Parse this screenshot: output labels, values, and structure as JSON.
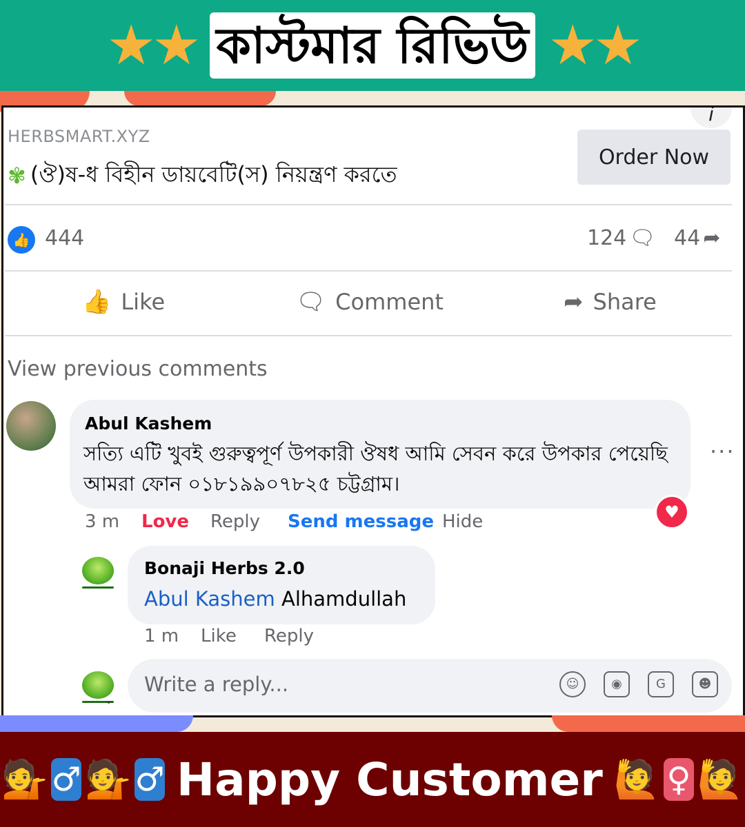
{
  "top_banner": {
    "title": "কাস্টমার রিভিউ",
    "stars_left": "★★",
    "stars_right": "★★",
    "accent": "#0ea987"
  },
  "ad": {
    "domain": "HERBSMART.XYZ",
    "headline": "(ঔ)ষ-ধ বিহীন ডায়বেটি(স) নিয়ন্ত্রণ করতে",
    "cta_label": "Order Now",
    "info_icon": "i"
  },
  "stats": {
    "likes": "444",
    "comments": "124",
    "shares": "44"
  },
  "actions": {
    "like": "Like",
    "comment": "Comment",
    "share": "Share"
  },
  "view_previous": "View previous comments",
  "comment": {
    "author": "Abul Kashem",
    "text": "সত্যি এটি খুবই গুরুত্বপূর্ণ উপকারী ঔষধ আমি সেবন করে উপকার পেয়েছি আমরা ফোন ০১৮১৯৯০৭৮২৫ চট্টগ্রাম।",
    "time": "3 m",
    "love_label": "Love",
    "reply_label": "Reply",
    "send_message_label": "Send message",
    "hide_label": "Hide",
    "love_color": "#f0284a"
  },
  "reply": {
    "author": "Bonaji Herbs 2.0",
    "mention": "Abul Kashem",
    "text": "Alhamdullah",
    "time": "1 m",
    "like_label": "Like",
    "reply_label": "Reply"
  },
  "write_reply": {
    "placeholder": "Write a reply...",
    "icons": [
      "emoji-icon",
      "camera-icon",
      "gif-icon",
      "sticker-icon"
    ]
  },
  "bottom_banner": {
    "text": "Happy Customer",
    "background": "#6d0000"
  }
}
